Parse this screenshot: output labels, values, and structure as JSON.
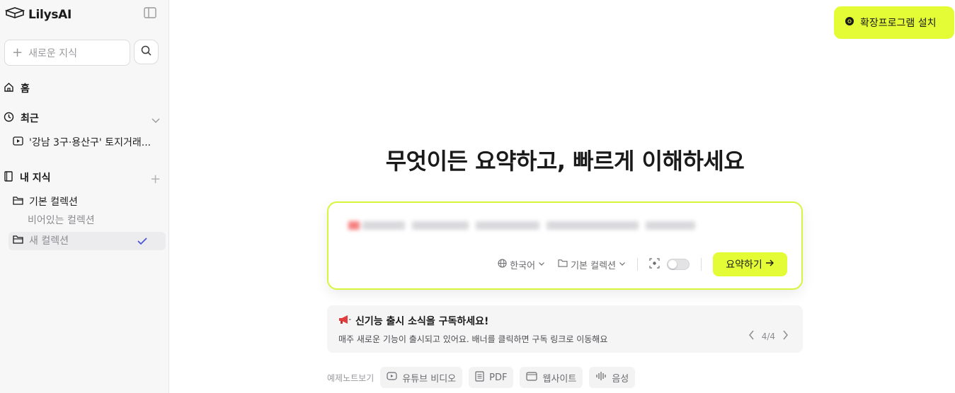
{
  "sidebar": {
    "logo_text": "LilysAI",
    "new_knowledge_placeholder": "새로운 지식",
    "home_label": "홈",
    "recent_label": "최근",
    "recent_items": [
      "'강남 3구·용산구' 토지거래..."
    ],
    "my_knowledge_label": "내 지식",
    "collections": [
      {
        "label": "기본 컬렉션",
        "empty_note": "비어있는 컬렉션"
      },
      {
        "label": "새 컬렉션",
        "selected": true
      }
    ]
  },
  "header": {
    "extension_button": "확장프로그램 설치"
  },
  "main": {
    "headline": "무엇이든 요약하고, 빠르게 이해하세요",
    "input_card": {
      "language": "한국어",
      "collection": "기본 컬렉션",
      "summarize_button": "요약하기",
      "toggle_on": false
    },
    "banner": {
      "title": "신기능 출시 소식을 구독하세요!",
      "subtitle": "매주 새로운 기능이 출시되고 있어요. 배너를 클릭하면 구독 링크로 이동해요",
      "pager": "4/4"
    },
    "examples": {
      "label": "예제노트보기",
      "chips": [
        "유튜브 비디오",
        "PDF",
        "웹사이트",
        "음성"
      ]
    }
  },
  "colors": {
    "accent": "#e4fc35",
    "card_border": "#d9f53b",
    "sidebar_bg": "#f7f7f8"
  }
}
